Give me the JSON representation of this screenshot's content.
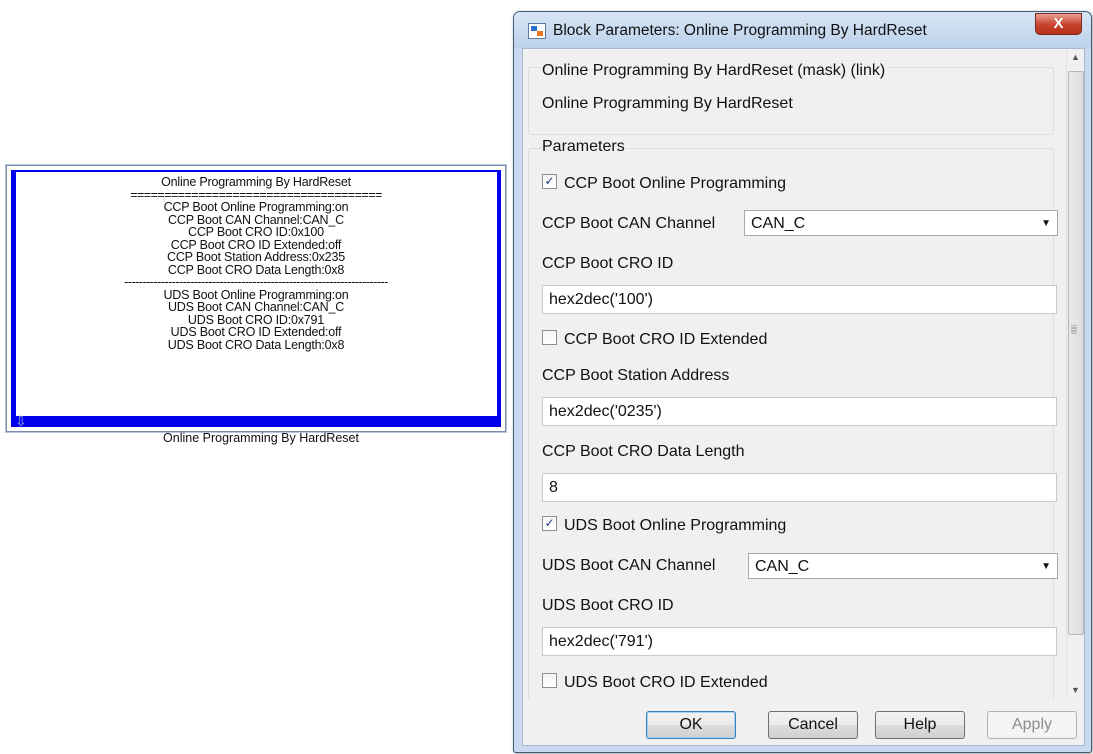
{
  "block": {
    "lines": [
      "Online Programming By HardReset",
      "=====================================",
      "CCP Boot Online Programming:on",
      "CCP Boot CAN Channel:CAN_C",
      "CCP Boot CRO ID:0x100",
      "CCP Boot CRO ID Extended:off",
      "CCP Boot Station Address:0x235",
      "CCP Boot CRO Data Length:0x8",
      "------------------------------------------------------------------------",
      "UDS Boot Online Programming:on",
      "UDS Boot CAN Channel:CAN_C",
      "UDS Boot CRO ID:0x791",
      "UDS Boot CRO ID Extended:off",
      "UDS Boot CRO Data Length:0x8"
    ],
    "caption": "Online Programming By HardReset",
    "port_icon": "down-arrow-icon"
  },
  "dialog": {
    "title": "Block Parameters: Online Programming By HardReset",
    "close_label": "X",
    "mask_title": "Online Programming By HardReset (mask) (link)",
    "mask_description": "Online Programming By HardReset",
    "params_title": "Parameters",
    "params": {
      "ccp_online_label": "CCP Boot Online Programming",
      "ccp_online_checked": true,
      "ccp_can_label": "CCP Boot CAN Channel",
      "ccp_can_value": "CAN_C",
      "ccp_cro_id_label": "CCP Boot CRO ID",
      "ccp_cro_id_value": "hex2dec('100')",
      "ccp_cro_ext_label": "CCP Boot CRO ID Extended",
      "ccp_cro_ext_checked": false,
      "ccp_station_label": "CCP Boot Station Address",
      "ccp_station_value": "hex2dec('0235')",
      "ccp_len_label": "CCP Boot CRO Data Length",
      "ccp_len_value": "8",
      "uds_online_label": "UDS Boot Online Programming",
      "uds_online_checked": true,
      "uds_can_label": "UDS Boot CAN Channel",
      "uds_can_value": "CAN_C",
      "uds_cro_id_label": "UDS Boot CRO ID",
      "uds_cro_id_value": "hex2dec('791')",
      "uds_cro_ext_label": "UDS Boot CRO ID Extended",
      "uds_cro_ext_checked": false
    },
    "buttons": {
      "ok": "OK",
      "cancel": "Cancel",
      "help": "Help",
      "apply": "Apply"
    },
    "check_mark": "✓",
    "combo_arrow": "▼"
  },
  "colors": {
    "block_border": "#0000ee",
    "titlebar": "#c9daf0",
    "close_button": "#c7412a"
  }
}
